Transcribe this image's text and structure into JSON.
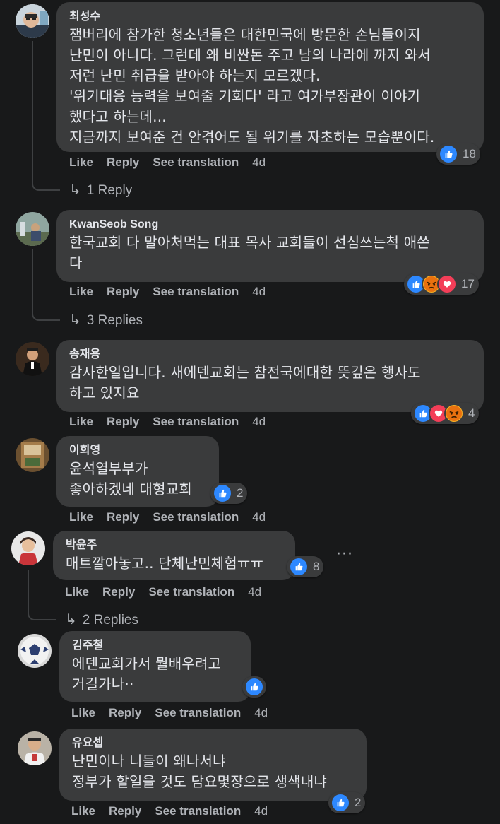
{
  "actions": {
    "like": "Like",
    "reply": "Reply",
    "translate": "See translation"
  },
  "comments": [
    {
      "name": "최성수",
      "text": "잼버리에 참가한 청소년들은 대한민국에 방문한 손님들이지\n난민이 아니다. 그런데 왜 비싼돈 주고 남의 나라에 까지 와서\n저런 난민 취급을 받아야 하는지 모르겠다.\n'위기대응 능력을 보여줄 기회다' 라고 여가부장관이 이야기\n했다고 하는데...\n지금까지 보여준 건 안겪어도 될 위기를 자초하는 모습뿐이다.",
      "reactions": [
        "like-icon"
      ],
      "count": "18",
      "time": "4d",
      "replies": "1 Reply"
    },
    {
      "name": "KwanSeob Song",
      "text": "한국교회 다 말아처먹는 대표 목사 교회들이 선심쓰는척 애쓴\n다",
      "reactions": [
        "like-icon",
        "angry-icon",
        "love-icon"
      ],
      "count": "17",
      "time": "4d",
      "replies": "3 Replies"
    },
    {
      "name": "송재용",
      "text": "감사한일입니다. 새에덴교회는 참전국에대한 뜻깊은 행사도\n하고 있지요",
      "reactions": [
        "like-icon",
        "love-icon",
        "angry-icon"
      ],
      "count": "4",
      "time": "4d"
    },
    {
      "name": "이희영",
      "text": "윤석열부부가\n좋아하겠네 대형교회",
      "reactions": [
        "like-icon"
      ],
      "count": "2",
      "time": "4d"
    },
    {
      "name": "박윤주",
      "text": "매트깔아놓고.. 단체난민체험ㅠㅠ",
      "reactions": [
        "like-icon"
      ],
      "count": "8",
      "time": "4d",
      "replies": "2 Replies",
      "more": "···"
    },
    {
      "name": "김주철",
      "text": "에덴교회가서 뭘배우려고\n거길가나··",
      "reactions": [
        "like-icon"
      ],
      "count": "",
      "time": "4d"
    },
    {
      "name": "유요셉",
      "text": "난민이나 니들이 왜나서냐\n정부가 할일을 것도 담요몇장으로 생색내냐",
      "reactions": [
        "like-icon"
      ],
      "count": "2",
      "time": "4d"
    }
  ],
  "colors": {
    "background": "#18191a",
    "bubble": "#3a3b3c",
    "like": "#2d88ff",
    "love": "#f33e58",
    "angry": "#f7b125"
  }
}
